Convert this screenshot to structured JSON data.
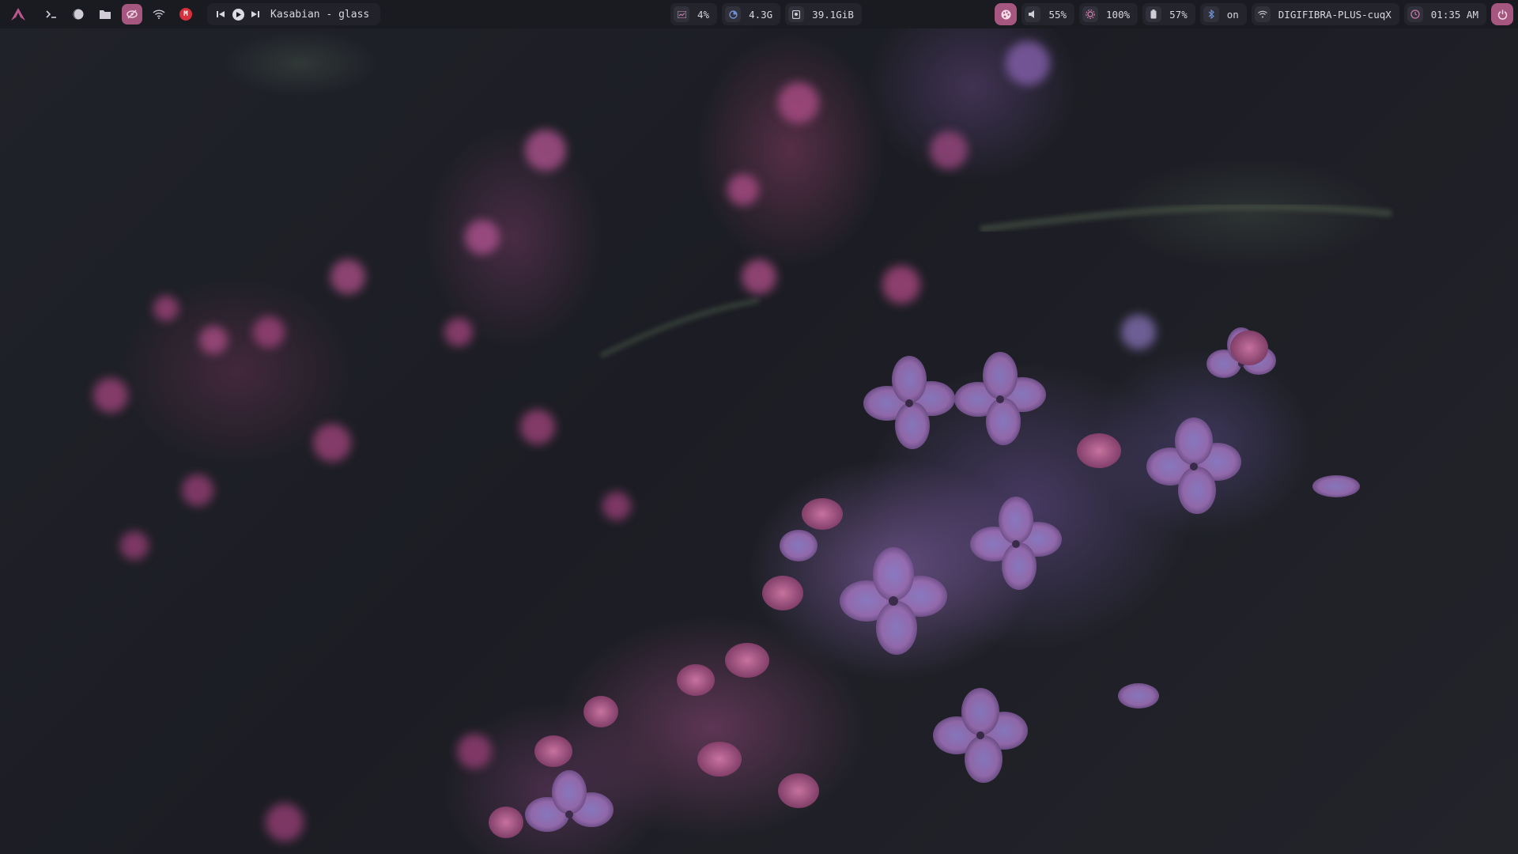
{
  "topbar": {
    "launcher_icon": "arch-linux-logo",
    "workspaces": [
      {
        "name": "terminal-icon",
        "glyph": "›_"
      },
      {
        "name": "firefox-icon",
        "glyph": "◐"
      },
      {
        "name": "folder-icon",
        "glyph": "▰"
      },
      {
        "name": "eye-slash-icon",
        "glyph": "◈",
        "active": true
      },
      {
        "name": "wifi-icon",
        "glyph": "≋"
      },
      {
        "name": "gmail-icon",
        "glyph": "M"
      }
    ],
    "media": {
      "prev_icon": "⏮",
      "play_icon": "▶",
      "next_icon": "⏭",
      "song": "Kasabian - glass"
    },
    "center_modules": [
      {
        "name": "cpu",
        "icon": "▦",
        "value": "4%"
      },
      {
        "name": "memory",
        "icon": "◕",
        "value": "4.3G"
      },
      {
        "name": "disk",
        "icon": "▣",
        "value": "39.1GiB"
      }
    ],
    "right_modules": [
      {
        "name": "volume",
        "icon": "◀",
        "value": "55%"
      },
      {
        "name": "brightness",
        "icon": "✺",
        "value": "100%"
      },
      {
        "name": "battery",
        "icon": "▮",
        "value": "57%"
      },
      {
        "name": "bluetooth",
        "icon": "ᛒ",
        "value": "on"
      },
      {
        "name": "network",
        "icon": "≋",
        "value": "DIGIFIBRA-PLUS-cuqX"
      },
      {
        "name": "clock",
        "icon": "◷",
        "value": "01:35 AM"
      }
    ],
    "accent_color": "#a6577f"
  }
}
